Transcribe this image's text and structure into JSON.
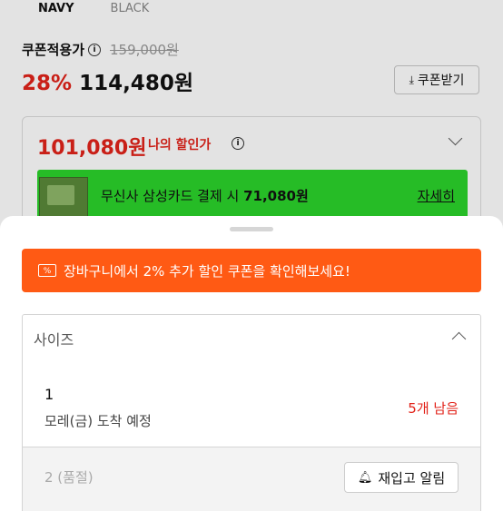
{
  "product": {
    "color_tabs": [
      "NAVY",
      "BLACK"
    ],
    "coupon_price_label": "쿠폰적용가",
    "info_glyph": "i",
    "original_price": "159,000원",
    "discount_rate": "28%",
    "sale_price": "114,480원",
    "coupon_button": "쿠폰받기"
  },
  "my_price": {
    "amount": "101,080원",
    "label": "나의 할인가",
    "card_banner": {
      "text_prefix": "무신사 삼성카드 결제 시",
      "text_amount": "71,080원",
      "detail_link": "자세히"
    }
  },
  "sheet": {
    "promo_text": "장바구니에서 2% 추가 할인 쿠폰을 확인해보세요!",
    "promo_icon_glyph": "%",
    "size_select_label": "사이즈",
    "options": [
      {
        "name": "1",
        "sub": "모레(금) 도착 예정",
        "stock": "5개 남음"
      },
      {
        "name": "2 (품절)",
        "restock_button": "재입고 알림"
      }
    ]
  },
  "icons": {
    "download": "download-icon",
    "info": "info-icon",
    "chevron": "chevron-icon",
    "bell": "bell-icon",
    "coupon": "coupon-icon"
  },
  "colors": {
    "accent_red": "#e2231a",
    "promo_orange": "#ff5a14",
    "card_green": "#2bd42b"
  }
}
